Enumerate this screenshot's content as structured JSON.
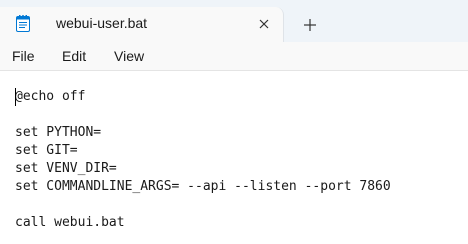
{
  "tab": {
    "title": "webui-user.bat",
    "app_icon": "notepad-icon",
    "close_icon": "close-icon"
  },
  "new_tab_icon": "plus-icon",
  "menu": {
    "file": "File",
    "edit": "Edit",
    "view": "View"
  },
  "editor": {
    "lines": [
      "@echo off",
      "",
      "set PYTHON=",
      "set GIT=",
      "set VENV_DIR=",
      "set COMMANDLINE_ARGS= --api --listen --port 7860",
      "",
      "call webui.bat"
    ]
  },
  "colors": {
    "tab_strip_bg": "#eff4f9",
    "active_tab_bg": "#f9f9f9",
    "editor_bg": "#ffffff",
    "text": "#1a1a1a",
    "icon_accent": "#0078d4"
  }
}
